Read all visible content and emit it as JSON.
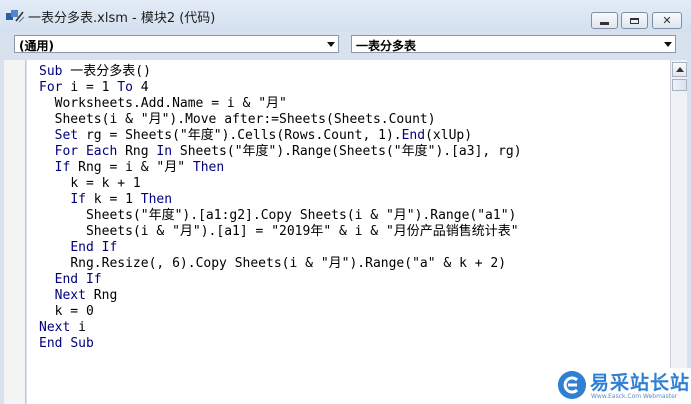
{
  "window": {
    "title": "一表分多表.xlsm - 模块2 (代码)",
    "icons": {
      "app": "vba-project-icon",
      "minimize": "minimize-icon",
      "maximize": "maximize-icon",
      "close": "close-icon"
    }
  },
  "combos": {
    "object": "(通用)",
    "procedure": "一表分多表"
  },
  "code": {
    "lines": [
      "Sub 一表分多表()",
      "For i = 1 To 4",
      "  Worksheets.Add.Name = i & \"月\"",
      "  Sheets(i & \"月\").Move after:=Sheets(Sheets.Count)",
      "  Set rg = Sheets(\"年度\").Cells(Rows.Count, 1).End(xlUp)",
      "  For Each Rng In Sheets(\"年度\").Range(Sheets(\"年度\").[a3], rg)",
      "  If Rng = i & \"月\" Then",
      "    k = k + 1",
      "    If k = 1 Then",
      "      Sheets(\"年度\").[a1:g2].Copy Sheets(i & \"月\").Range(\"a1\")",
      "      Sheets(i & \"月\").[a1] = \"2019年\" & i & \"月份产品销售统计表\"",
      "    End If",
      "    Rng.Resize(, 6).Copy Sheets(i & \"月\").Range(\"a\" & k + 2)",
      "  End If",
      "  Next Rng",
      "  k = 0",
      "Next i",
      "End Sub"
    ],
    "keywords": [
      "Sub",
      "For",
      "To",
      "Set",
      "Each",
      "In",
      "If",
      "Then",
      "End",
      "Next"
    ]
  },
  "watermark": {
    "name": "易采站长站",
    "sub": "Www.Easck.Com Webmaster"
  },
  "colors": {
    "keyword": "#00007f",
    "text": "#000000",
    "brand": "#2f7fd3"
  }
}
